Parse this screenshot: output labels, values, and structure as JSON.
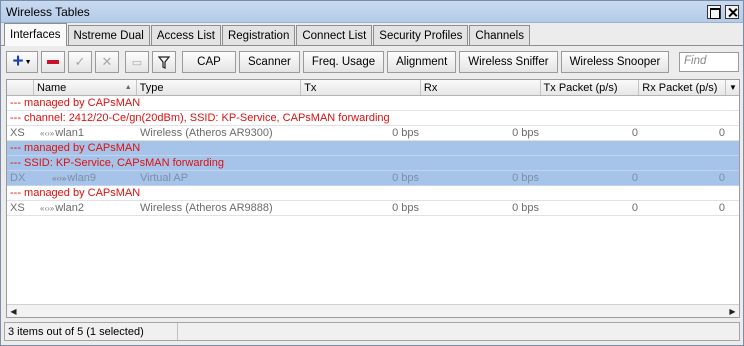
{
  "window": {
    "title": "Wireless Tables"
  },
  "tabs": [
    "Interfaces",
    "Nstreme Dual",
    "Access List",
    "Registration",
    "Connect List",
    "Security Profiles",
    "Channels"
  ],
  "toolbar": {
    "buttons": [
      "CAP",
      "Scanner",
      "Freq. Usage",
      "Alignment",
      "Wireless Sniffer",
      "Wireless Snooper"
    ],
    "find_placeholder": "Find"
  },
  "table": {
    "columns": [
      "",
      "Name",
      "Type",
      "Tx",
      "Rx",
      "Tx Packet (p/s)",
      "Rx Packet (p/s)"
    ],
    "rows": [
      {
        "kind": "comment",
        "text": "--- managed by CAPsMAN",
        "selected": false
      },
      {
        "kind": "comment",
        "text": "--- channel: 2412/20-Ce/gn(20dBm), SSID: KP-Service, CAPsMAN forwarding",
        "selected": false
      },
      {
        "kind": "data",
        "flags": "XS",
        "name": "wlan1",
        "type": "Wireless (Atheros AR9300)",
        "tx": "0 bps",
        "rx": "0 bps",
        "txp": "0",
        "rxp": "0",
        "selected": false
      },
      {
        "kind": "comment",
        "text": "--- managed by CAPsMAN",
        "selected": true
      },
      {
        "kind": "comment",
        "text": "--- SSID: KP-Service, CAPsMAN forwarding",
        "selected": true
      },
      {
        "kind": "data",
        "flags": "DX",
        "name": "wlan9",
        "type": "Virtual AP",
        "tx": "0 bps",
        "rx": "0 bps",
        "txp": "0",
        "rxp": "0",
        "selected": true
      },
      {
        "kind": "comment",
        "text": "--- managed by CAPsMAN",
        "selected": false
      },
      {
        "kind": "data",
        "flags": "XS",
        "name": "wlan2",
        "type": "Wireless (Atheros AR9888)",
        "tx": "0 bps",
        "rx": "0 bps",
        "txp": "0",
        "rxp": "0",
        "selected": false
      }
    ]
  },
  "status": {
    "text": "3 items out of 5 (1 selected)"
  },
  "icons": {
    "add": "plus-icon",
    "remove": "minus-icon",
    "enable": "check-icon",
    "disable": "cross-icon",
    "comment": "note-icon",
    "filter": "filter-icon",
    "interface": "wireless-interface-icon"
  },
  "colors": {
    "comment": "#dd1010",
    "selected_row": "#a6c4e9",
    "title_bar": "#c3d5ee"
  }
}
